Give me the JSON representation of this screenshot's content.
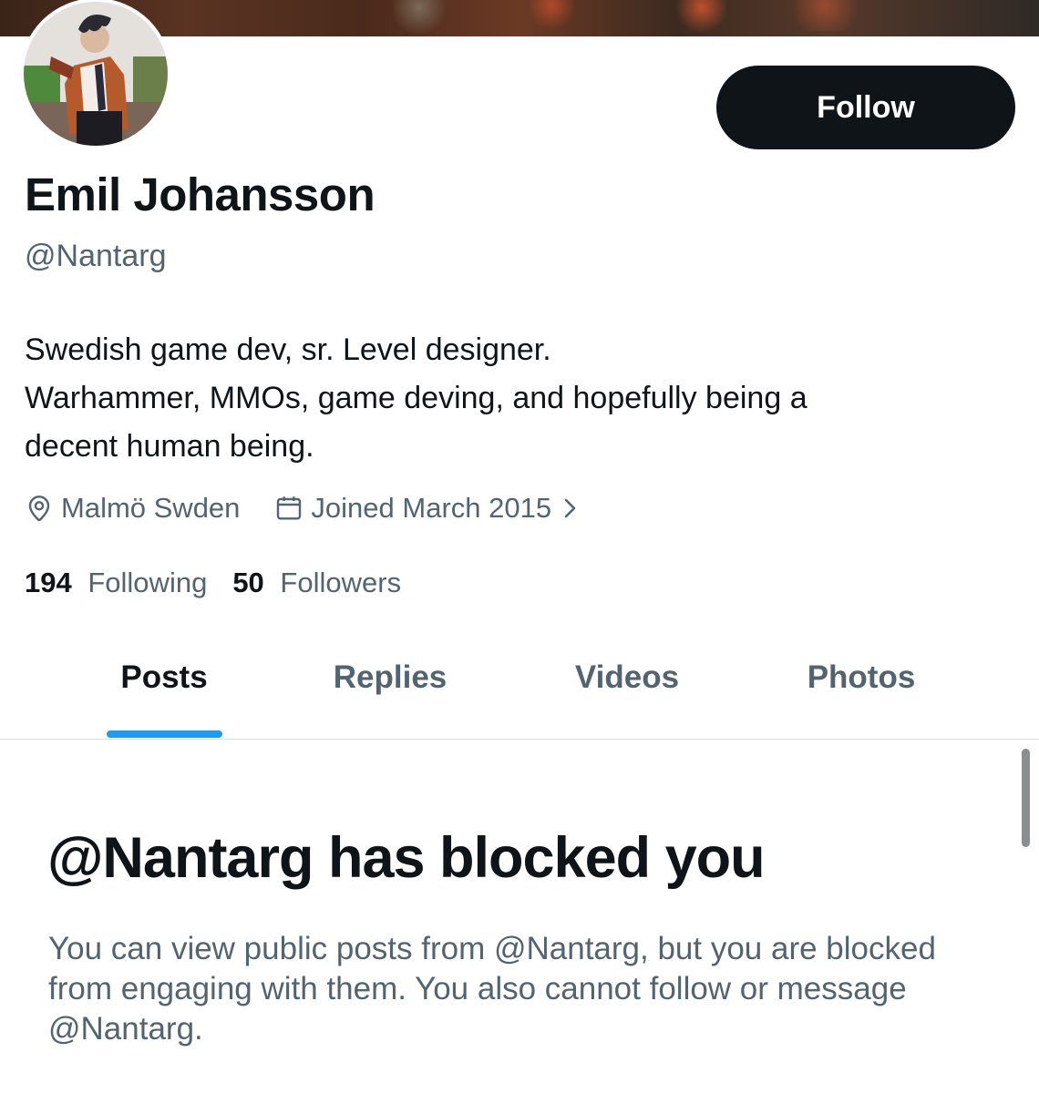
{
  "profile": {
    "name": "Emil Johansson",
    "handle": "@Nantarg",
    "bio_lines": [
      "Swedish game dev, sr. Level designer.",
      "Warhammer, MMOs, game deving, and hopefully being a",
      "decent human being."
    ],
    "location": "Malmö Swden",
    "joined": "Joined March 2015",
    "following_count": "194",
    "following_label": "Following",
    "followers_count": "50",
    "followers_label": "Followers"
  },
  "actions": {
    "follow_label": "Follow"
  },
  "icons": {
    "location": "location-pin-icon",
    "calendar": "calendar-icon",
    "chevron": "chevron-right-icon"
  },
  "tabs": [
    {
      "label": "Posts",
      "active": true
    },
    {
      "label": "Replies",
      "active": false
    },
    {
      "label": "Videos",
      "active": false
    },
    {
      "label": "Photos",
      "active": false
    }
  ],
  "blocked": {
    "title": "@Nantarg has blocked you",
    "message": "You can view public posts from @Nantarg, but you are blocked from engaging with them. You also cannot follow or message @Nantarg."
  },
  "colors": {
    "text_primary": "#0f1419",
    "text_secondary": "#536471",
    "accent": "#1d9bf0",
    "button_bg": "#0f1419"
  }
}
